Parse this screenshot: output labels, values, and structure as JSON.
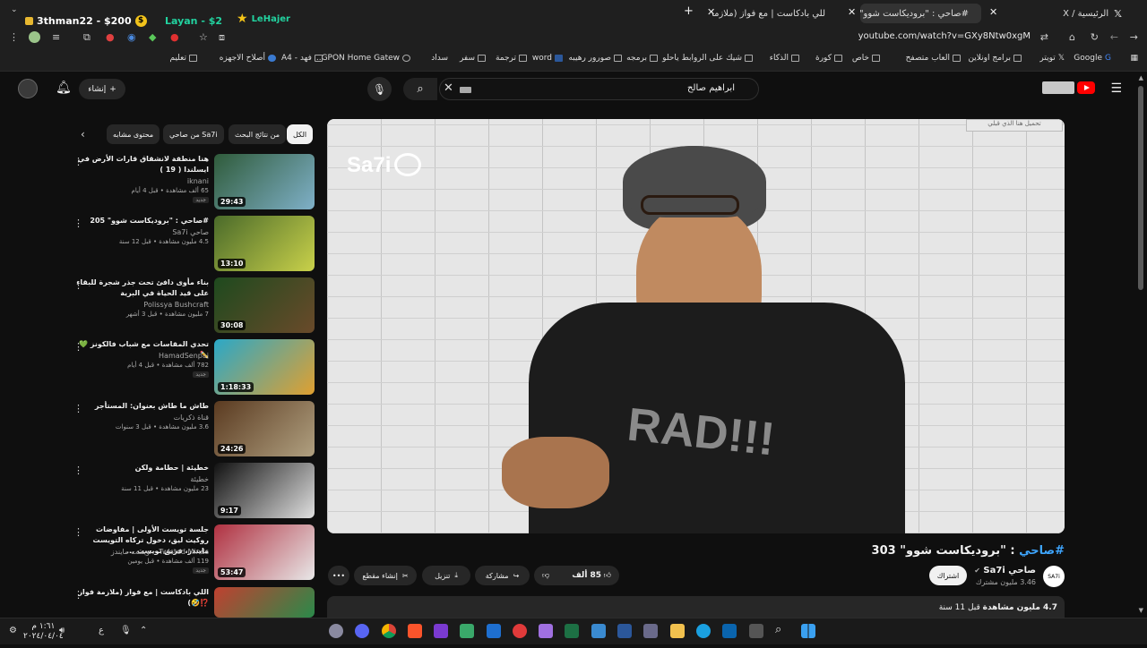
{
  "browser": {
    "tabs": [
      {
        "label": "الرئيسية / X"
      },
      {
        "label": "#صاحي : \"بروديكاست شوو\" 303"
      },
      {
        "label": "للي بادكاست | مع فواز (ملازمة د"
      }
    ],
    "new_tab": "+",
    "url": "youtube.com/watch?v=GXy8Ntw0xgM",
    "overlay": {
      "player1": "3thman22 - $200",
      "player2": "Layan - $2",
      "player3": "LeHajer"
    }
  },
  "bookmarks": [
    "Google",
    "تويتر",
    "برامج اونلاين",
    "العاب متصفح",
    "خاص",
    "كورة",
    "الذكاء",
    "شيك على الروابط ياحلو",
    "برمجه",
    "صورور رهيبه",
    "word",
    "ترجمة",
    "سفر",
    "سداد",
    "GPON Home Gatew...",
    "فهد - A4",
    "أصلاح الاجهزه",
    "تعليم"
  ],
  "youtube": {
    "search_query": "ابراهيم صالح",
    "create_label": "إنشاء",
    "chips": [
      "الكل",
      "من نتائج البحث",
      "من صاحي Sa7i",
      "محتوى مشابه"
    ],
    "player": {
      "logo": "Sa7i",
      "ad_badge": "تحميل هنا الذي قبلي",
      "shirt": "RAD!!!"
    },
    "video": {
      "title_tag": "#صاحي",
      "title_rest": " : \"بروديكاست شوو\" 303",
      "channel": "صاحي Sa7i",
      "avatar": "SA7i",
      "subs": "3.46 مليون مشترك",
      "subscribe": "اشتراك",
      "likes": "85 ألف",
      "share": "مشاركة",
      "download": "تنزيل",
      "clip": "إنشاء مقطع",
      "more": "•••",
      "desc_views": "4.7 مليون مشاهدة",
      "desc_age": "قبل 11 سنة"
    },
    "related": [
      {
        "title": "هنا منطقة لانشقاق قارات الأرض في ايسلندا ( 19 )",
        "channel": "iknani",
        "meta": "65 ألف مشاهدة • قبل 4 أيام",
        "new": "جديد",
        "dur": "29:43",
        "c1": "#2f5b3a",
        "c2": "#7fb0c8"
      },
      {
        "title": "#صاحي : \"بروديكاست شوو\" 205",
        "channel": "صاحي Sa7i",
        "meta": "4.5 مليون مشاهدة • قبل 12 سنة",
        "new": "",
        "dur": "13:10",
        "c1": "#4a6a2a",
        "c2": "#c9d14a"
      },
      {
        "title": "بناء مأوى دافئ تحت جذر شجرة للبقاء على قيد الحياة في البرية",
        "channel": "Polissya Bushcraft",
        "meta": "7 مليون مشاهدة • قبل 3 أشهر",
        "new": "",
        "dur": "30:08",
        "c1": "#1e4a1e",
        "c2": "#6a4a2a"
      },
      {
        "title": "تحدي المقاسات مع شباب فالكونز 💚✏️",
        "channel": "HamadSenpai",
        "meta": "782 ألف مشاهدة • قبل 4 أيام",
        "new": "جديد",
        "dur": "1:18:33",
        "c1": "#2aa8c8",
        "c2": "#e0a030"
      },
      {
        "title": "طاش ما طاش بعنوان: المستأجر",
        "channel": "قناة ذكريات",
        "meta": "3.6 مليون مشاهدة • قبل 3 سنوات",
        "new": "",
        "dur": "24:26",
        "c1": "#5a3a20",
        "c2": "#b0a080"
      },
      {
        "title": "خطيئة | حطامة ولكن",
        "channel": "خطيئة",
        "meta": "23 مليون مشاهدة • قبل 11 سنة",
        "new": "",
        "dur": "9:17",
        "c1": "#111111",
        "c2": "#e0e0e0"
      },
      {
        "title": "جلسة تويست الأولى | مفاوضات روكيت ليق، دخول تركاه التويست مايندز، فريق تويست ...",
        "channel": "Twisted Minds - تويست مايندز",
        "meta": "119 ألف مشاهدة • قبل يومين",
        "new": "جديد",
        "dur": "53:47",
        "c1": "#b03040",
        "c2": "#e8e8e8"
      },
      {
        "title": "اللي بادكاست | مع فواز (ملازمة فواز ⁉️🤣)",
        "channel": "",
        "meta": "",
        "new": "",
        "dur": "",
        "c1": "#c04030",
        "c2": "#2a8a4a"
      }
    ]
  },
  "taskbar": {
    "time": "١:٦١ م",
    "date": "٢٠٢٤/٠٤/٠٤",
    "lang": "ع"
  },
  "colors": {
    "accent_red": "#ff0000",
    "link_blue": "#3ea6ff",
    "bg": "#0f0f0f"
  }
}
